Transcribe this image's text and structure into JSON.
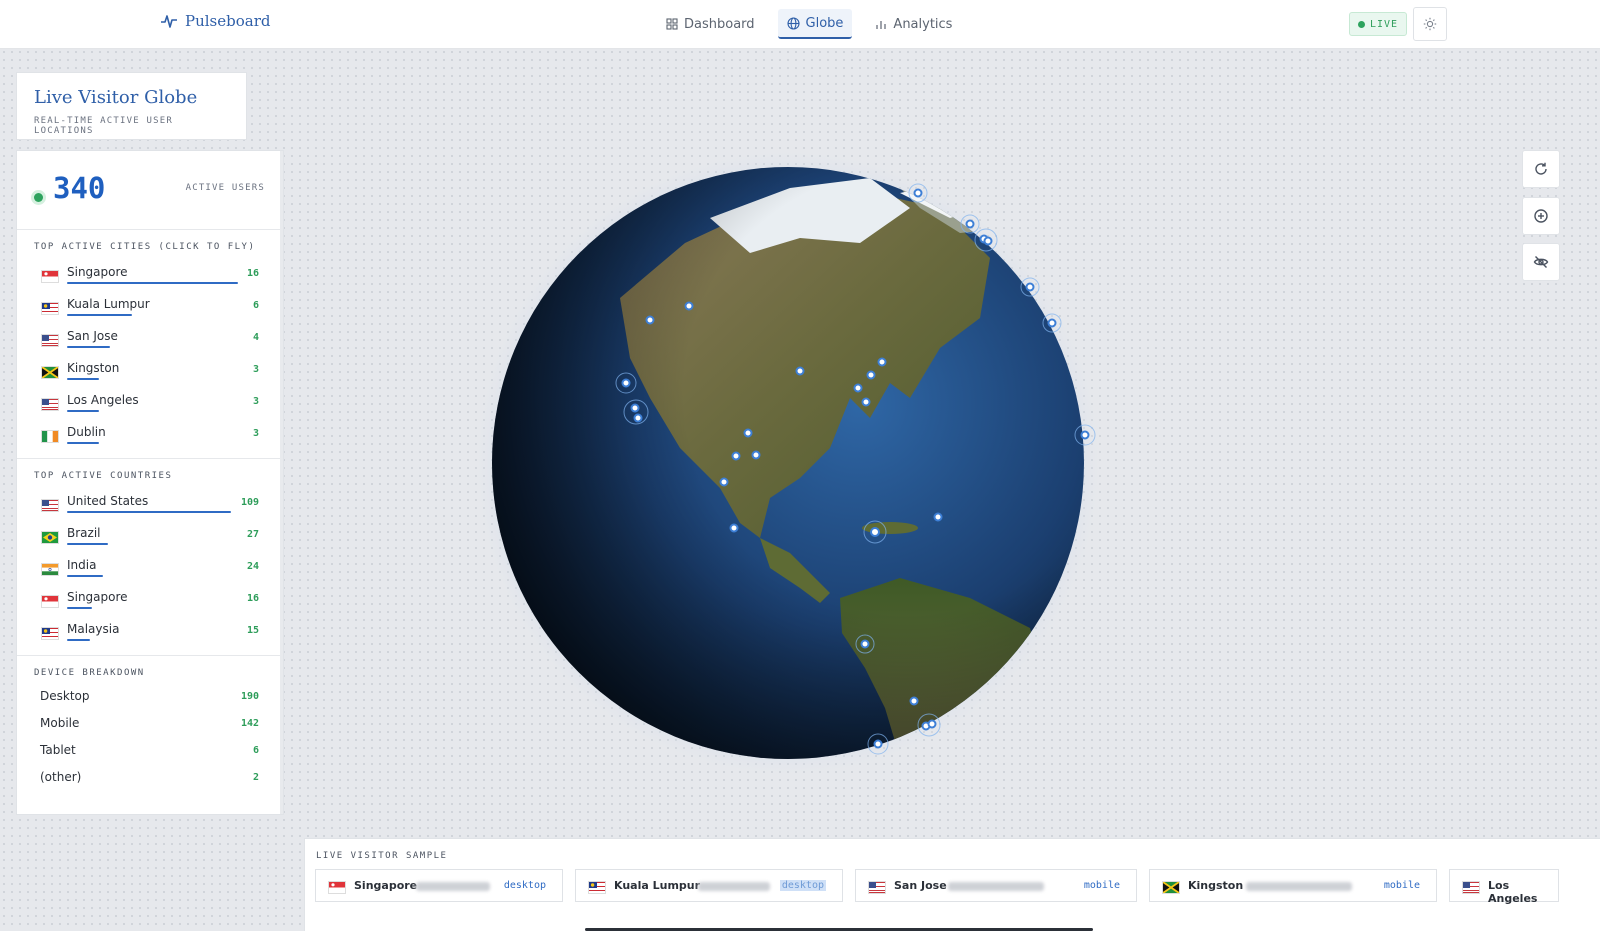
{
  "brand": {
    "name": "Pulseboard"
  },
  "nav": {
    "tabs": [
      {
        "label": "Dashboard"
      },
      {
        "label": "Globe"
      },
      {
        "label": "Analytics"
      }
    ]
  },
  "status": {
    "live_label": "LIVE"
  },
  "panel": {
    "title": "Live Visitor Globe",
    "subtitle": "REAL-TIME ACTIVE USER LOCATIONS",
    "active_count": "340",
    "active_label": "ACTIVE USERS"
  },
  "cities": {
    "title": "TOP ACTIVE CITIES (CLICK TO FLY)",
    "items": [
      {
        "name": "Singapore",
        "count": "16",
        "flag": "sg",
        "share": 1.0
      },
      {
        "name": "Kuala Lumpur",
        "count": "6",
        "flag": "my",
        "share": 0.38
      },
      {
        "name": "San Jose",
        "count": "4",
        "flag": "us",
        "share": 0.25
      },
      {
        "name": "Kingston",
        "count": "3",
        "flag": "jm",
        "share": 0.19
      },
      {
        "name": "Los Angeles",
        "count": "3",
        "flag": "us",
        "share": 0.19
      },
      {
        "name": "Dublin",
        "count": "3",
        "flag": "ie",
        "share": 0.19
      }
    ]
  },
  "countries": {
    "title": "TOP ACTIVE COUNTRIES",
    "items": [
      {
        "name": "United States",
        "count": "109",
        "flag": "us",
        "share": 1.0
      },
      {
        "name": "Brazil",
        "count": "27",
        "flag": "br",
        "share": 0.25
      },
      {
        "name": "India",
        "count": "24",
        "flag": "in",
        "share": 0.22
      },
      {
        "name": "Singapore",
        "count": "16",
        "flag": "sg",
        "share": 0.15
      },
      {
        "name": "Malaysia",
        "count": "15",
        "flag": "my",
        "share": 0.14
      }
    ]
  },
  "devices": {
    "title": "DEVICE BREAKDOWN",
    "items": [
      {
        "name": "Desktop",
        "count": "190"
      },
      {
        "name": "Mobile",
        "count": "142"
      },
      {
        "name": "Tablet",
        "count": "6"
      },
      {
        "name": "(other)",
        "count": "2"
      }
    ]
  },
  "sample": {
    "title": "LIVE VISITOR SAMPLE",
    "items": [
      {
        "city": "Singapore",
        "flag": "sg",
        "device": "desktop"
      },
      {
        "city": "Kuala Lumpur",
        "flag": "my",
        "device": "desktop"
      },
      {
        "city": "San Jose",
        "flag": "us",
        "device": "mobile"
      },
      {
        "city": "Kingston",
        "flag": "jm",
        "device": "mobile"
      },
      {
        "city": "Los Angeles",
        "flag": "us",
        "device": ""
      }
    ]
  },
  "icons": {
    "brand": "pulse-icon",
    "dashboard": "grid-icon",
    "globe": "globe-icon",
    "analytics": "bar-chart-icon",
    "theme": "sun-icon",
    "controls": [
      "refresh-icon",
      "target-icon",
      "eye-off-icon"
    ]
  },
  "colors": {
    "accent": "#2f5fa8",
    "live": "#2ea35e",
    "bar": "#2f6bc4"
  }
}
